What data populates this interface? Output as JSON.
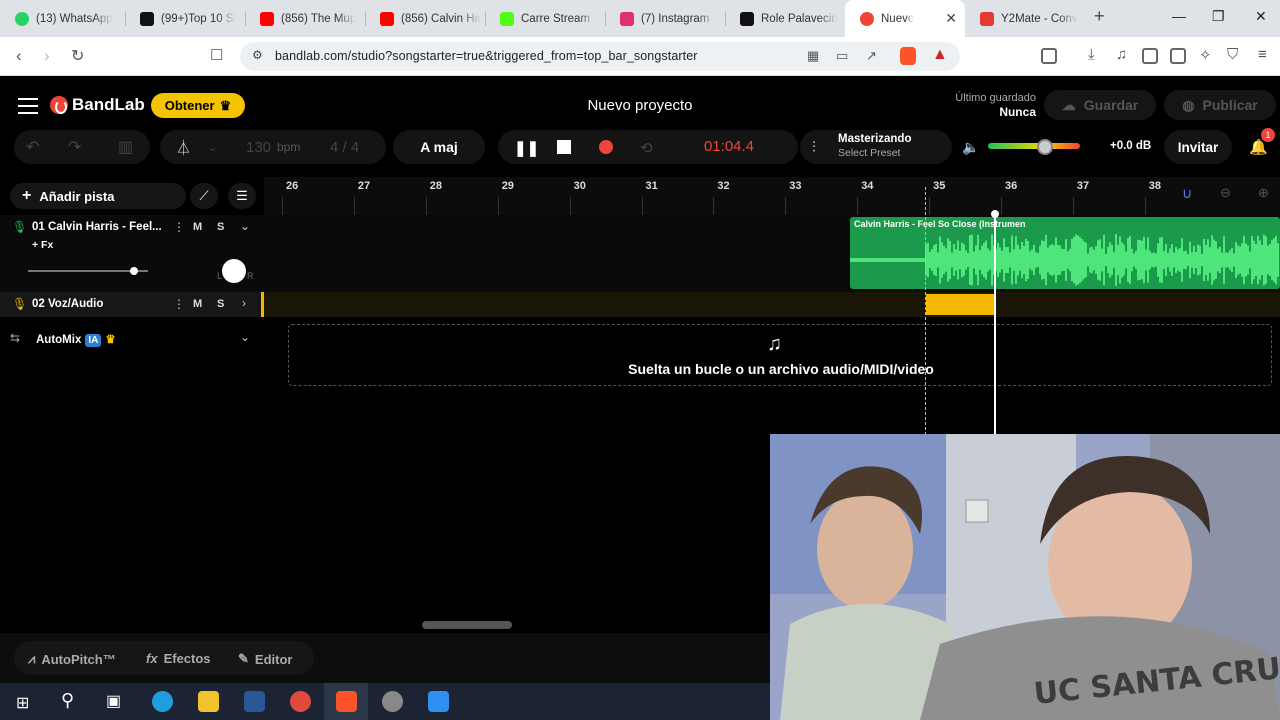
{
  "browser": {
    "tabs": [
      {
        "title": "(13) WhatsApp",
        "color": "#25d366"
      },
      {
        "title": "(99+)Top 10 Si",
        "color": "#111111"
      },
      {
        "title": "(856) The Mup",
        "color": "#ff0000"
      },
      {
        "title": "(856) Calvin Ha",
        "color": "#ff0000"
      },
      {
        "title": "Carre Stream -",
        "color": "#53fc18"
      },
      {
        "title": "(7) Instagram -",
        "color": "#e1306c"
      },
      {
        "title": "Role Palavecin",
        "color": "#111111"
      },
      {
        "title": "Nuevo",
        "color": "#f0443a"
      },
      {
        "title": "Y2Mate - Conv",
        "color": "#e53935"
      }
    ],
    "url": "bandlab.com/studio?songstarter=true&triggered_from=top_bar_songstarter"
  },
  "header": {
    "brand": "BandLab",
    "get_button": "Obtener",
    "project_title": "Nuevo proyecto",
    "last_saved_label": "Último guardado",
    "last_saved_value": "Nunca",
    "save_button": "Guardar",
    "publish_button": "Publicar"
  },
  "toolbar": {
    "bpm_value": "130",
    "bpm_unit": "bpm",
    "time_signature": "4 / 4",
    "key": "A maj",
    "time": "01:04.4",
    "mastering_title": "Masterizando",
    "mastering_preset": "Select Preset",
    "volume_db": "+0.0 dB",
    "volume_level": 0.62,
    "invite_button": "Invitar",
    "notifications_count": "1"
  },
  "tracks_panel": {
    "add_track": "Añadir pista",
    "tracks": [
      {
        "name": "01  Calvin Harris - Feel...",
        "fx": "+ Fx",
        "mute": "M",
        "solo": "S",
        "volume_level": 0.85,
        "pan_l": "L",
        "pan_r": "R"
      },
      {
        "name": "02  Voz/Audio",
        "mute": "M",
        "solo": "S"
      }
    ],
    "automix": "AutoMix",
    "ia_badge": "IA"
  },
  "timeline": {
    "bars": [
      "26",
      "27",
      "28",
      "29",
      "30",
      "31",
      "32",
      "33",
      "34",
      "35",
      "36",
      "37",
      "38"
    ],
    "region_title": "Calvin Harris - Feel So Close (Instrumen",
    "drop_text": "Suelta un bucle o un archivo audio/MIDI/video"
  },
  "bottom": {
    "autopitch": "AutoPitch™",
    "effects": "Efectos",
    "editor": "Editor"
  },
  "colors": {
    "accent_red": "#f0443a",
    "gold": "#f5c400",
    "region_green": "#1a9a4a",
    "waveform": "#5fff8a"
  }
}
